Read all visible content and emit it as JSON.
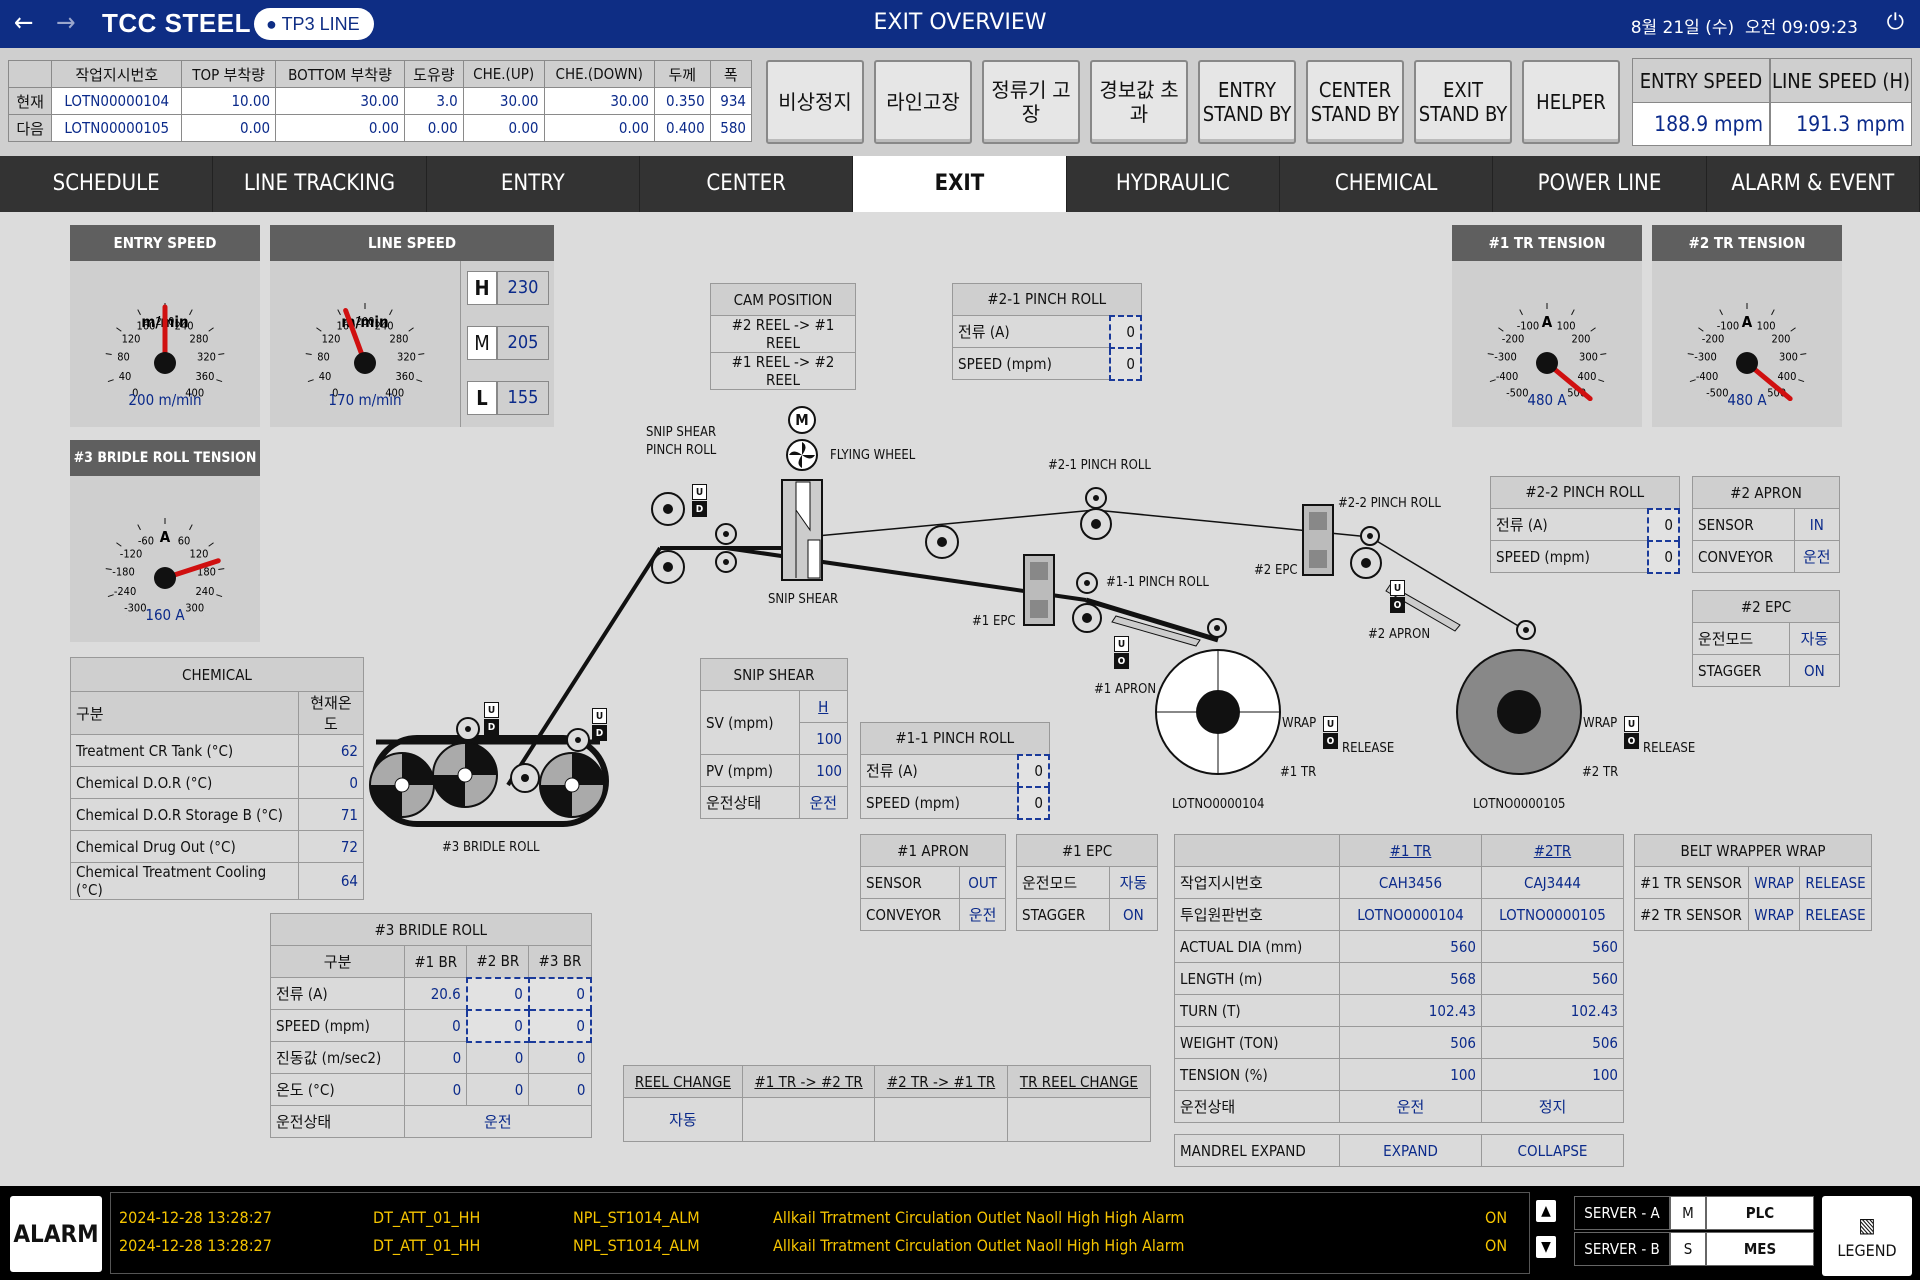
{
  "header": {
    "brand": "TCC STEEL",
    "line_badge": "TP3 LINE",
    "title": "EXIT OVERVIEW",
    "date": "8월 21일 (수)",
    "time": "오전 09:09:23",
    "back_icon": "arrow-left-icon",
    "forward_icon": "arrow-right-icon",
    "power_icon": "power-icon",
    "pin_icon": "location-pin-icon"
  },
  "work_order": {
    "headers": [
      "작업지시번호",
      "TOP 부착량",
      "BOTTOM 부착량",
      "도유량",
      "CHE.(UP)",
      "CHE.(DOWN)",
      "두께",
      "폭"
    ],
    "rows": [
      {
        "label": "현재",
        "values": [
          "LOTN00000104",
          "10.00",
          "30.00",
          "3.0",
          "30.00",
          "30.00",
          "0.350",
          "934"
        ]
      },
      {
        "label": "다음",
        "values": [
          "LOTN00000105",
          "0.00",
          "0.00",
          "0.00",
          "0.00",
          "0.00",
          "0.400",
          "580"
        ]
      }
    ]
  },
  "commands": [
    "비상정지",
    "라인고장",
    "정류기 고장",
    "경보값 초과",
    "ENTRY\nSTAND BY",
    "CENTER\nSTAND BY",
    "EXIT\nSTAND BY",
    "HELPER"
  ],
  "speed_summary": {
    "entry_label": "ENTRY SPEED",
    "entry_value": "188.9 mpm",
    "line_label": "LINE SPEED (H)",
    "line_value": "191.3 mpm"
  },
  "tabs": [
    "SCHEDULE",
    "LINE TRACKING",
    "ENTRY",
    "CENTER",
    "EXIT",
    "HYDRAULIC",
    "CHEMICAL",
    "POWER LINE",
    "ALARM & EVENT"
  ],
  "active_tab": "EXIT",
  "gauges": {
    "entry_speed": {
      "title": "ENTRY SPEED",
      "unit": "m/min",
      "readout": "200 m/min",
      "ticks": [
        "0",
        "40",
        "80",
        "120",
        "160",
        "200",
        "240",
        "280",
        "320",
        "360",
        "400"
      ],
      "value": 200,
      "min": 0,
      "max": 400
    },
    "line_speed": {
      "title": "LINE SPEED",
      "unit": "m/min",
      "readout": "170 m/min",
      "ticks": [
        "0",
        "40",
        "80",
        "120",
        "160",
        "200",
        "240",
        "280",
        "320",
        "360",
        "400"
      ],
      "value": 170,
      "min": 0,
      "max": 400
    },
    "bridle_tension": {
      "title": "#3 BRIDLE ROLL TENSION",
      "unit": "A",
      "readout": "160 A",
      "ticks": [
        "-300",
        "-240",
        "-180",
        "-120",
        "-60",
        "0",
        "60",
        "120",
        "180",
        "240",
        "300"
      ],
      "value": 160,
      "min": -300,
      "max": 300
    },
    "tr1_tension": {
      "title": "#1 TR TENSION",
      "unit": "A",
      "readout": "480 A",
      "ticks": [
        "-500",
        "-400",
        "-300",
        "-200",
        "-100",
        "0",
        "100",
        "200",
        "300",
        "400",
        "500"
      ],
      "value": 480,
      "min": -500,
      "max": 500
    },
    "tr2_tension": {
      "title": "#2 TR TENSION",
      "unit": "A",
      "readout": "480 A",
      "ticks": [
        "-500",
        "-400",
        "-300",
        "-200",
        "-100",
        "0",
        "100",
        "200",
        "300",
        "400",
        "500"
      ],
      "value": 480,
      "min": -500,
      "max": 500
    }
  },
  "speed_presets": [
    {
      "key": "H",
      "value": "230"
    },
    {
      "key": "M",
      "value": "205"
    },
    {
      "key": "L",
      "value": "155"
    }
  ],
  "chemical": {
    "title": "CHEMICAL",
    "col1": "구분",
    "col2": "현재온도",
    "rows": [
      {
        "name": "Treatment CR Tank (°C)",
        "value": "62"
      },
      {
        "name": "Chemical D.O.R (°C)",
        "value": "0"
      },
      {
        "name": "Chemical D.O.R Storage B (°C)",
        "value": "71"
      },
      {
        "name": "Chemical Drug Out (°C)",
        "value": "72"
      },
      {
        "name": "Chemical Treatment Cooling (°C)",
        "value": "64"
      }
    ]
  },
  "bridle": {
    "title": "#3 BRIDLE ROLL",
    "headers": [
      "구분",
      "#1 BR",
      "#2 BR",
      "#3 BR"
    ],
    "rows": [
      {
        "name": "전류 (A)",
        "values": [
          "20.6",
          "0",
          "0"
        ]
      },
      {
        "name": "SPEED (mpm)",
        "values": [
          "0",
          "0",
          "0"
        ]
      },
      {
        "name": "진동값 (m/sec2)",
        "values": [
          "0",
          "0",
          "0"
        ]
      },
      {
        "name": "온도 (°C)",
        "values": [
          "0",
          "0",
          "0"
        ]
      }
    ],
    "status_label": "운전상태",
    "status_value": "운전"
  },
  "cam_position": {
    "title": "CAM POSITION",
    "rows": [
      "#2 REEL -> #1 REEL",
      "#1 REEL  -> #2 REEL"
    ]
  },
  "pinch_2_1": {
    "title": "#2-1 PINCH ROLL",
    "rows": [
      {
        "name": "전류 (A)",
        "value": "0"
      },
      {
        "name": "SPEED (mpm)",
        "value": "0"
      }
    ]
  },
  "pinch_1_1": {
    "title": "#1-1 PINCH ROLL",
    "rows": [
      {
        "name": "전류 (A)",
        "value": "0"
      },
      {
        "name": "SPEED (mpm)",
        "value": "0"
      }
    ]
  },
  "pinch_2_2": {
    "title": "#2-2 PINCH ROLL",
    "rows": [
      {
        "name": "전류 (A)",
        "value": "0"
      },
      {
        "name": "SPEED (mpm)",
        "value": "0"
      }
    ]
  },
  "snip_shear": {
    "title": "SNIP SHEAR",
    "sv_label": "SV (mpm)",
    "sv_mode": "H",
    "sv_value": "100",
    "pv_label": "PV (mpm)",
    "pv_value": "100",
    "status_label": "운전상태",
    "status_value": "운전"
  },
  "apron1": {
    "title": "#1 APRON",
    "rows": [
      {
        "name": "SENSOR",
        "value": "OUT"
      },
      {
        "name": "CONVEYOR",
        "value": "운전"
      }
    ]
  },
  "epc1": {
    "title": "#1 EPC",
    "rows": [
      {
        "name": "운전모드",
        "value": "자동"
      },
      {
        "name": "STAGGER",
        "value": "ON"
      }
    ]
  },
  "apron2": {
    "title": "#2 APRON",
    "rows": [
      {
        "name": "SENSOR",
        "value": "IN"
      },
      {
        "name": "CONVEYOR",
        "value": "운전"
      }
    ]
  },
  "epc2": {
    "title": "#2 EPC",
    "rows": [
      {
        "name": "운전모드",
        "value": "자동"
      },
      {
        "name": "STAGGER",
        "value": "ON"
      }
    ]
  },
  "tension_reel": {
    "headers": [
      "",
      "#1 TR",
      "#2TR"
    ],
    "rows": [
      {
        "name": "작업지시번호",
        "values": [
          "CAH3456",
          "CAJ3444"
        ],
        "align": "c"
      },
      {
        "name": "투입원판번호",
        "values": [
          "LOTNO0000104",
          "LOTNO0000105"
        ],
        "align": "c"
      },
      {
        "name": "ACTUAL DIA (mm)",
        "values": [
          "560",
          "560"
        ],
        "align": "r"
      },
      {
        "name": "LENGTH (m)",
        "values": [
          "568",
          "560"
        ],
        "align": "r"
      },
      {
        "name": "TURN (T)",
        "values": [
          "102.43",
          "102.43"
        ],
        "align": "r"
      },
      {
        "name": "WEIGHT (TON)",
        "values": [
          "506",
          "506"
        ],
        "align": "r"
      },
      {
        "name": "TENSION (%)",
        "values": [
          "100",
          "100"
        ],
        "align": "r"
      },
      {
        "name": "운전상태",
        "values": [
          "운전",
          "정지"
        ],
        "align": "c"
      }
    ],
    "mandrel_label": "MANDREL EXPAND",
    "mandrel_values": [
      "EXPAND",
      "COLLAPSE"
    ]
  },
  "belt_wrapper": {
    "title": "BELT WRAPPER WRAP",
    "rows": [
      {
        "name": "#1 TR SENSOR",
        "a": "WRAP",
        "b": "RELEASE"
      },
      {
        "name": "#2 TR SENSOR",
        "a": "WRAP",
        "b": "RELEASE"
      }
    ]
  },
  "reel_change": {
    "headers": [
      "REEL CHANGE",
      "#1 TR -> #2 TR",
      "#2 TR -> #1 TR",
      "TR REEL CHANGE"
    ],
    "values": [
      "자동",
      "",
      "",
      ""
    ]
  },
  "diagram": {
    "snip_shear_pinch": "SNIP SHEAR\nPINCH ROLL",
    "flying_wheel": "FLYING WHEEL",
    "snip_shear": "SNIP SHEAR",
    "pinch_2_1": "#2-1 PINCH ROLL",
    "pinch_2_2": "#2-2 PINCH ROLL",
    "pinch_1_1": "#1-1 PINCH ROLL",
    "epc1": "#1 EPC",
    "epc2": "#2 EPC",
    "apron1": "#1 APRON",
    "apron2": "#2 APRON",
    "bridle": "#3 BRIDLE ROLL",
    "wrap": "WRAP",
    "release": "RELEASE",
    "tr1": "#1 TR",
    "tr2": "#2 TR",
    "coil1": "LOTNO0000104",
    "coil2": "LOTNO0000105",
    "up_mark": "U",
    "down_mark": "D",
    "open_mark": "O",
    "motor_mark": "M"
  },
  "alarm": {
    "button": "ALARM",
    "rows": [
      {
        "time": "2024-12-28 13:28:27",
        "tag": "DT_ATT_01_HH",
        "code": "NPL_ST1014_ALM",
        "message": "Allkail Trratment Circulation Outlet Naoll High High Alarm",
        "state": "ON"
      },
      {
        "time": "2024-12-28 13:28:27",
        "tag": "DT_ATT_01_HH",
        "code": "NPL_ST1014_ALM",
        "message": "Allkail Trratment Circulation Outlet Naoll High High Alarm",
        "state": "ON"
      }
    ]
  },
  "server": {
    "a": "SERVER - A",
    "b": "SERVER - B",
    "m": "M",
    "s": "S",
    "plc": "PLC",
    "mes": "MES"
  },
  "legend": "LEGEND"
}
